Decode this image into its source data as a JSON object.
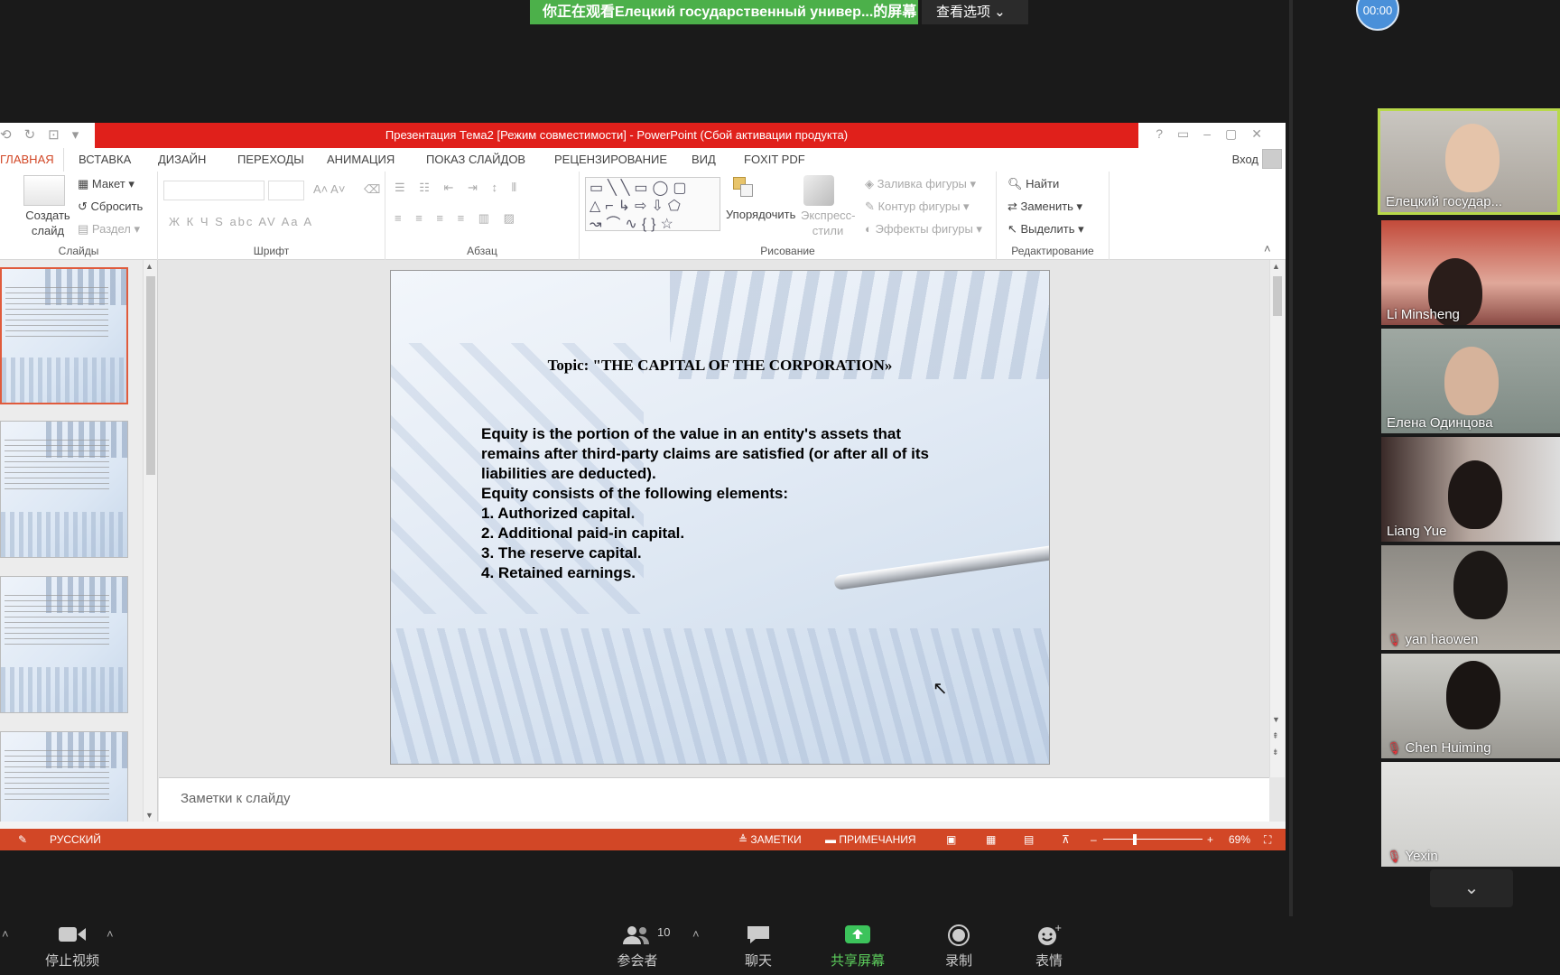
{
  "share_banner": {
    "text": "你正在观看Елецкий государственный универ...的屏幕",
    "options": "查看选项 ⌄"
  },
  "timer": "00:00",
  "ppt": {
    "title": "Презентация Тема2 [Режим совместимости] - PowerPoint (Сбой активации продукта)",
    "tabs": [
      "ГЛАВНАЯ",
      "ВСТАВКА",
      "ДИЗАЙН",
      "ПЕРЕХОДЫ",
      "АНИМАЦИЯ",
      "ПОКАЗ СЛАЙДОВ",
      "РЕЦЕНЗИРОВАНИЕ",
      "ВИД",
      "FOXIT PDF"
    ],
    "signin": "Вход",
    "ribbon": {
      "create_slide": "Создать слайд",
      "layout": "Макет",
      "reset": "Сбросить",
      "section": "Раздел",
      "group_slides": "Слайды",
      "group_font": "Шрифт",
      "group_paragraph": "Абзац",
      "group_drawing": "Рисование",
      "group_editing": "Редактирование",
      "arrange": "Упорядочить",
      "express_styles": "Экспресс-стили",
      "shape_fill": "Заливка фигуры",
      "shape_outline": "Контур фигуры",
      "shape_effects": "Эффекты фигуры",
      "find": "Найти",
      "replace": "Заменить",
      "select": "Выделить",
      "font_buttons": [
        "Ж",
        "К",
        "Ч",
        "S",
        "abc",
        "AV",
        "Aa",
        "A"
      ]
    },
    "slide": {
      "title": "Topic: \"THE CAPITAL OF THE CORPORATION»",
      "body": [
        "Equity is the portion of the value in an entity's assets that",
        "remains after third-party claims are satisfied (or after all of its",
        "liabilities are deducted).",
        "Equity consists of the following elements:",
        "1. Authorized capital.",
        "2. Additional paid-in capital.",
        "3. The reserve capital.",
        "4. Retained earnings."
      ]
    },
    "notes_placeholder": "Заметки к слайду",
    "status": {
      "language": "РУССКИЙ",
      "notes": "ЗАМЕТКИ",
      "comments": "ПРИМЕЧАНИЯ",
      "zoom": "69%"
    }
  },
  "participants": [
    {
      "name": "Елецкий государ...",
      "muted": false,
      "active": true
    },
    {
      "name": "Li Minsheng",
      "muted": false
    },
    {
      "name": "Елена Одинцова",
      "muted": false
    },
    {
      "name": "Liang Yue",
      "muted": false
    },
    {
      "name": "yan haowen",
      "muted": true
    },
    {
      "name": "Chen Huiming",
      "muted": true
    },
    {
      "name": "Yexin",
      "muted": true
    }
  ],
  "toolbar": {
    "stop_video": "停止视频",
    "participants": "参会者",
    "participants_count": "10",
    "chat": "聊天",
    "share_screen": "共享屏幕",
    "record": "录制",
    "reactions": "表情"
  },
  "colors": {
    "ppt_red": "#d24726",
    "zoom_green": "#4cb04a",
    "active_border": "#b8d94a"
  }
}
